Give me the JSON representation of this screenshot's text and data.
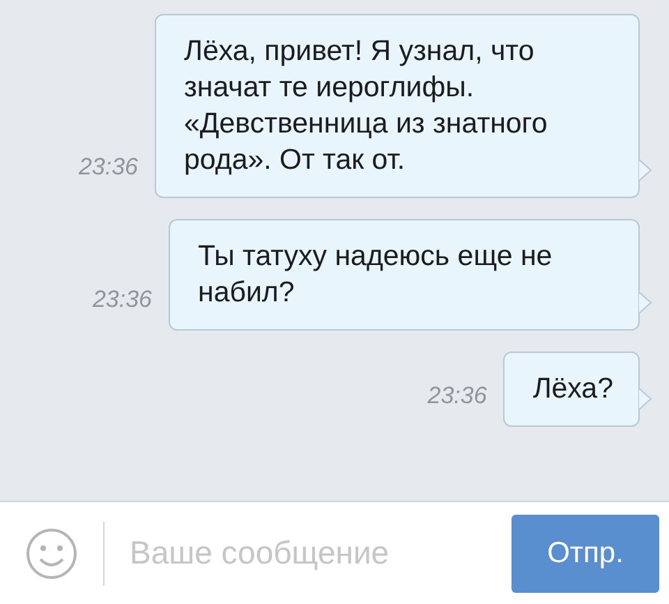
{
  "messages": [
    {
      "text": "Лёха, привет! Я узнал, что значат те иероглифы. «Девственница из знатного рода». От так от.",
      "time": "23:36",
      "outgoing": true
    },
    {
      "text": "Ты татуху надеюсь еще не набил?",
      "time": "23:36",
      "outgoing": true
    },
    {
      "text": "Лёха?",
      "time": "23:36",
      "outgoing": true
    }
  ],
  "composer": {
    "placeholder": "Ваше сообщение",
    "send_button": "Отпр."
  }
}
